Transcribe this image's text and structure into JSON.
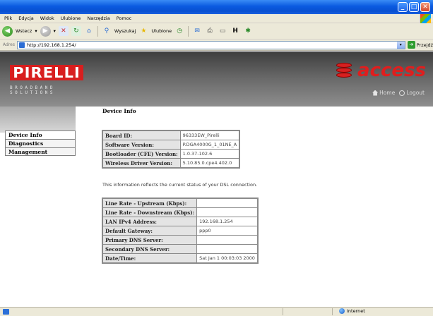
{
  "menu": [
    "Plik",
    "Edycja",
    "Widok",
    "Ulubione",
    "Narzędzia",
    "Pomoc"
  ],
  "toolbar": {
    "back_label": "Wstecz",
    "search_label": "Wyszukaj",
    "favorites_label": "Ulubione"
  },
  "address": {
    "label": "Adres",
    "url": "http://192.168.1.254/",
    "go_label": "Przejdź"
  },
  "banner": {
    "brand": "IRELLI",
    "brand_prefix": "P",
    "subtitle_line1": "BROADBAND",
    "subtitle_line2": "SOLUTIONS",
    "product": "access",
    "home_label": "Home",
    "logout_label": "Logout"
  },
  "nav": {
    "items": [
      {
        "label": "Device Info",
        "active": true
      },
      {
        "label": "Diagnostics",
        "active": false
      },
      {
        "label": "Management",
        "active": false
      }
    ]
  },
  "main": {
    "title": "Device Info",
    "info_table": [
      {
        "label": "Board ID:",
        "value": "96333EW_Pirelli"
      },
      {
        "label": "Software Version:",
        "value": "P.DGA4000G_1_01NE_A"
      },
      {
        "label": "Bootloader (CFE) Version:",
        "value": "1.0.37-102.6"
      },
      {
        "label": "Wireless Driver Version:",
        "value": "5.10.85.0.cpe4.402.0"
      }
    ],
    "status_text": "This information reflects the current status of your DSL connection.",
    "status_table": [
      {
        "label": "Line Rate - Upstream (Kbps):",
        "value": ""
      },
      {
        "label": "Line Rate - Downstream (Kbps):",
        "value": ""
      },
      {
        "label": "LAN IPv4 Address:",
        "value": "192.168.1.254"
      },
      {
        "label": "Default Gateway:",
        "value": "ppp0"
      },
      {
        "label": "Primary DNS Server:",
        "value": ""
      },
      {
        "label": "Secondary DNS Server:",
        "value": ""
      },
      {
        "label": "Date/Time:",
        "value": "Sat Jan 1 00:03:03 2000"
      }
    ]
  },
  "statusbar": {
    "zone": "Internet"
  },
  "colors": {
    "brand_red": "#d81e1e",
    "titlebar_blue": "#0a5ae0"
  }
}
